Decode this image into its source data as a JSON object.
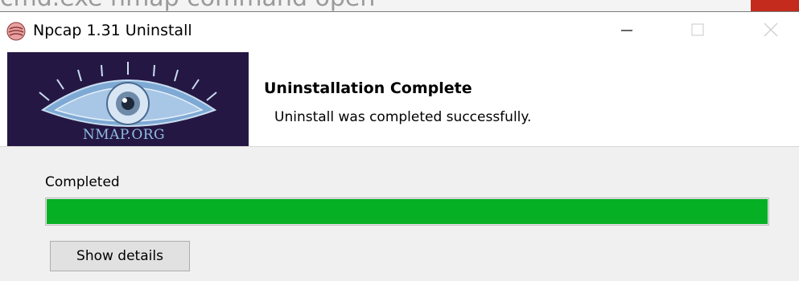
{
  "window": {
    "title": "Npcap 1.31 Uninstall"
  },
  "background_window": {
    "text": "cmd.exe nmap command open"
  },
  "header": {
    "banner_text": "NMAP.ORG",
    "title": "Uninstallation Complete",
    "subtitle": "Uninstall was completed successfully."
  },
  "status": {
    "label": "Completed",
    "progress_percent": 100
  },
  "buttons": {
    "show_details": "Show details"
  },
  "icons": {
    "app": "npcap-installer-icon",
    "minimize": "minimize-icon",
    "maximize": "maximize-icon",
    "close": "close-icon"
  },
  "colors": {
    "progress_fill": "#06b025",
    "banner_bg": "#251743",
    "banner_text": "#8fbde3",
    "close_hover_red": "#c42b1c"
  }
}
